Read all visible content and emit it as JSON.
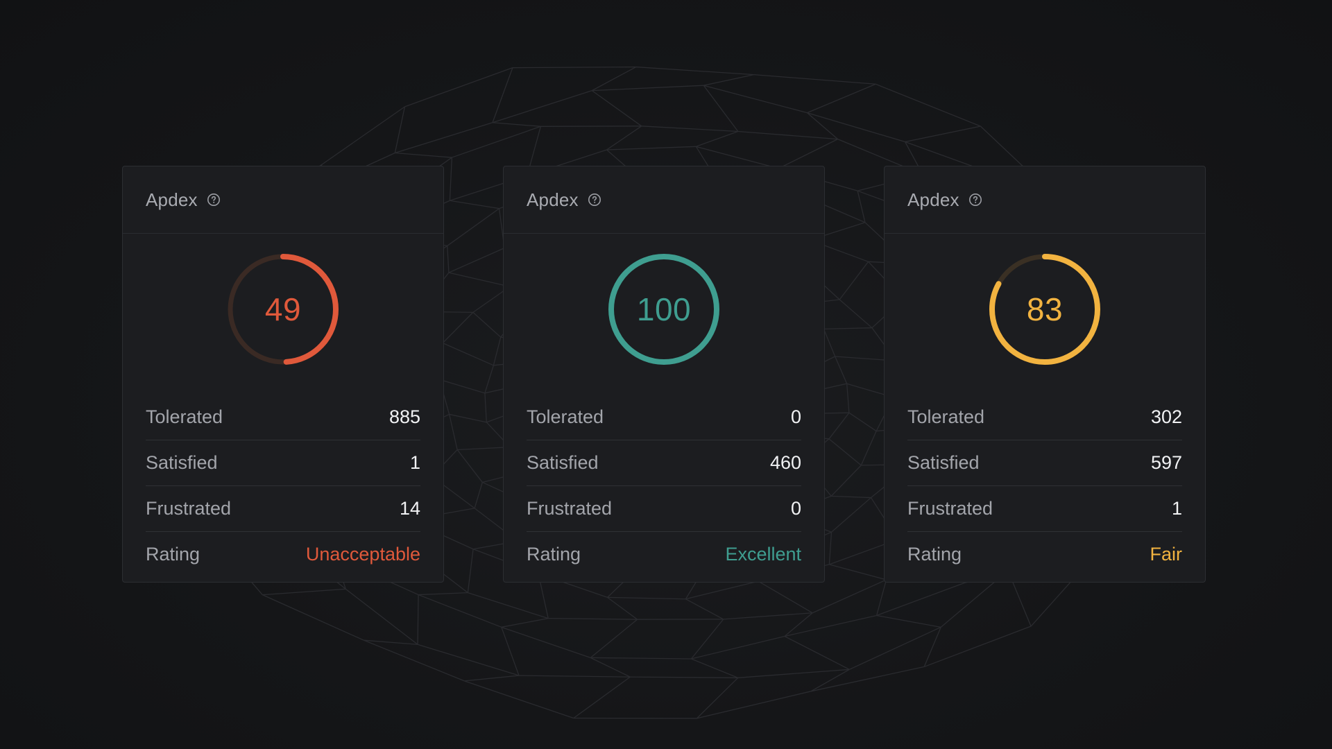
{
  "cards": [
    {
      "title": "Apdex",
      "score": 49,
      "score_label": "49",
      "color": "#e0593b",
      "track_color": "#3a2a24",
      "rows": [
        {
          "label": "Tolerated",
          "value": "885"
        },
        {
          "label": "Satisfied",
          "value": "1"
        },
        {
          "label": "Frustrated",
          "value": "14"
        },
        {
          "label": "Rating",
          "value": "Unacceptable"
        }
      ]
    },
    {
      "title": "Apdex",
      "score": 100,
      "score_label": "100",
      "color": "#3f9e90",
      "track_color": "#24332f",
      "rows": [
        {
          "label": "Tolerated",
          "value": "0"
        },
        {
          "label": "Satisfied",
          "value": "460"
        },
        {
          "label": "Frustrated",
          "value": "0"
        },
        {
          "label": "Rating",
          "value": "Excellent"
        }
      ]
    },
    {
      "title": "Apdex",
      "score": 83,
      "score_label": "83",
      "color": "#f2b340",
      "track_color": "#3a3024",
      "rows": [
        {
          "label": "Tolerated",
          "value": "302"
        },
        {
          "label": "Satisfied",
          "value": "597"
        },
        {
          "label": "Frustrated",
          "value": "1"
        },
        {
          "label": "Rating",
          "value": "Fair"
        }
      ]
    }
  ]
}
